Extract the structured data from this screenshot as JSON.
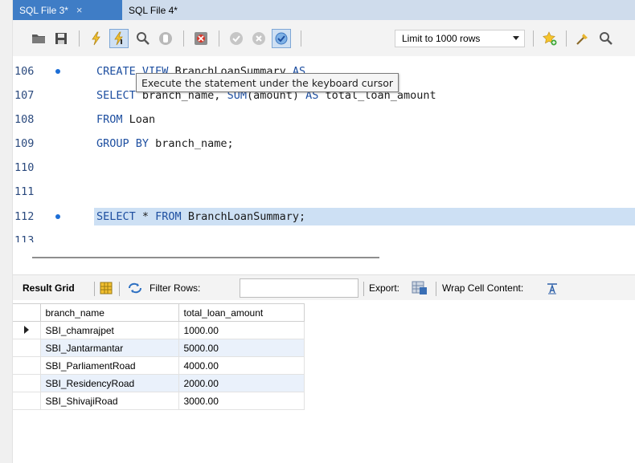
{
  "tabs": [
    {
      "label": "SQL File 3*",
      "close": "×"
    },
    {
      "label": "SQL File 4*"
    }
  ],
  "toolbar": {
    "limit_value": "Limit to 1000 rows",
    "icons": [
      "folder-open-icon",
      "save-icon",
      "execute-icon",
      "execute-cursor-icon",
      "find-icon",
      "stop-icon",
      "toggle-error-icon",
      "commit-icon",
      "rollback-icon",
      "autocommit-icon",
      "bookmark-add-icon",
      "beautify-icon",
      "search-icon"
    ]
  },
  "editor": {
    "lines": [
      {
        "num": "106",
        "dot": true,
        "text": "CREATE VIEW BranchLoanSummary AS"
      },
      {
        "num": "107",
        "dot": false,
        "text": "SELECT branch_name, SUM(amount) AS total_loan_amount"
      },
      {
        "num": "108",
        "dot": false,
        "text": "FROM Loan"
      },
      {
        "num": "109",
        "dot": false,
        "text": "GROUP BY branch_name;"
      },
      {
        "num": "110",
        "dot": false,
        "text": ""
      },
      {
        "num": "111",
        "dot": false,
        "text": ""
      },
      {
        "num": "112",
        "dot": true,
        "text": "SELECT * FROM BranchLoanSummary;"
      },
      {
        "num": "113",
        "dot": false,
        "text": ""
      }
    ],
    "tooltip": "Execute the statement under the keyboard cursor"
  },
  "result_toolbar": {
    "result_grid": "Result Grid",
    "filter_rows": "Filter Rows:",
    "export": "Export:",
    "wrap": "Wrap Cell Content:"
  },
  "grid": {
    "columns": [
      "branch_name",
      "total_loan_amount"
    ],
    "rows": [
      [
        "SBI_chamrajpet",
        "1000.00"
      ],
      [
        "SBI_Jantarmantar",
        "5000.00"
      ],
      [
        "SBI_ParliamentRoad",
        "4000.00"
      ],
      [
        "SBI_ResidencyRoad",
        "2000.00"
      ],
      [
        "SBI_ShivajiRoad",
        "3000.00"
      ]
    ]
  },
  "colors": {
    "active_tab": "#3f7dc6",
    "highlight_line": "#cde0f4",
    "keyword": "#1e4fa0",
    "alt_row": "#eaf1fb"
  }
}
